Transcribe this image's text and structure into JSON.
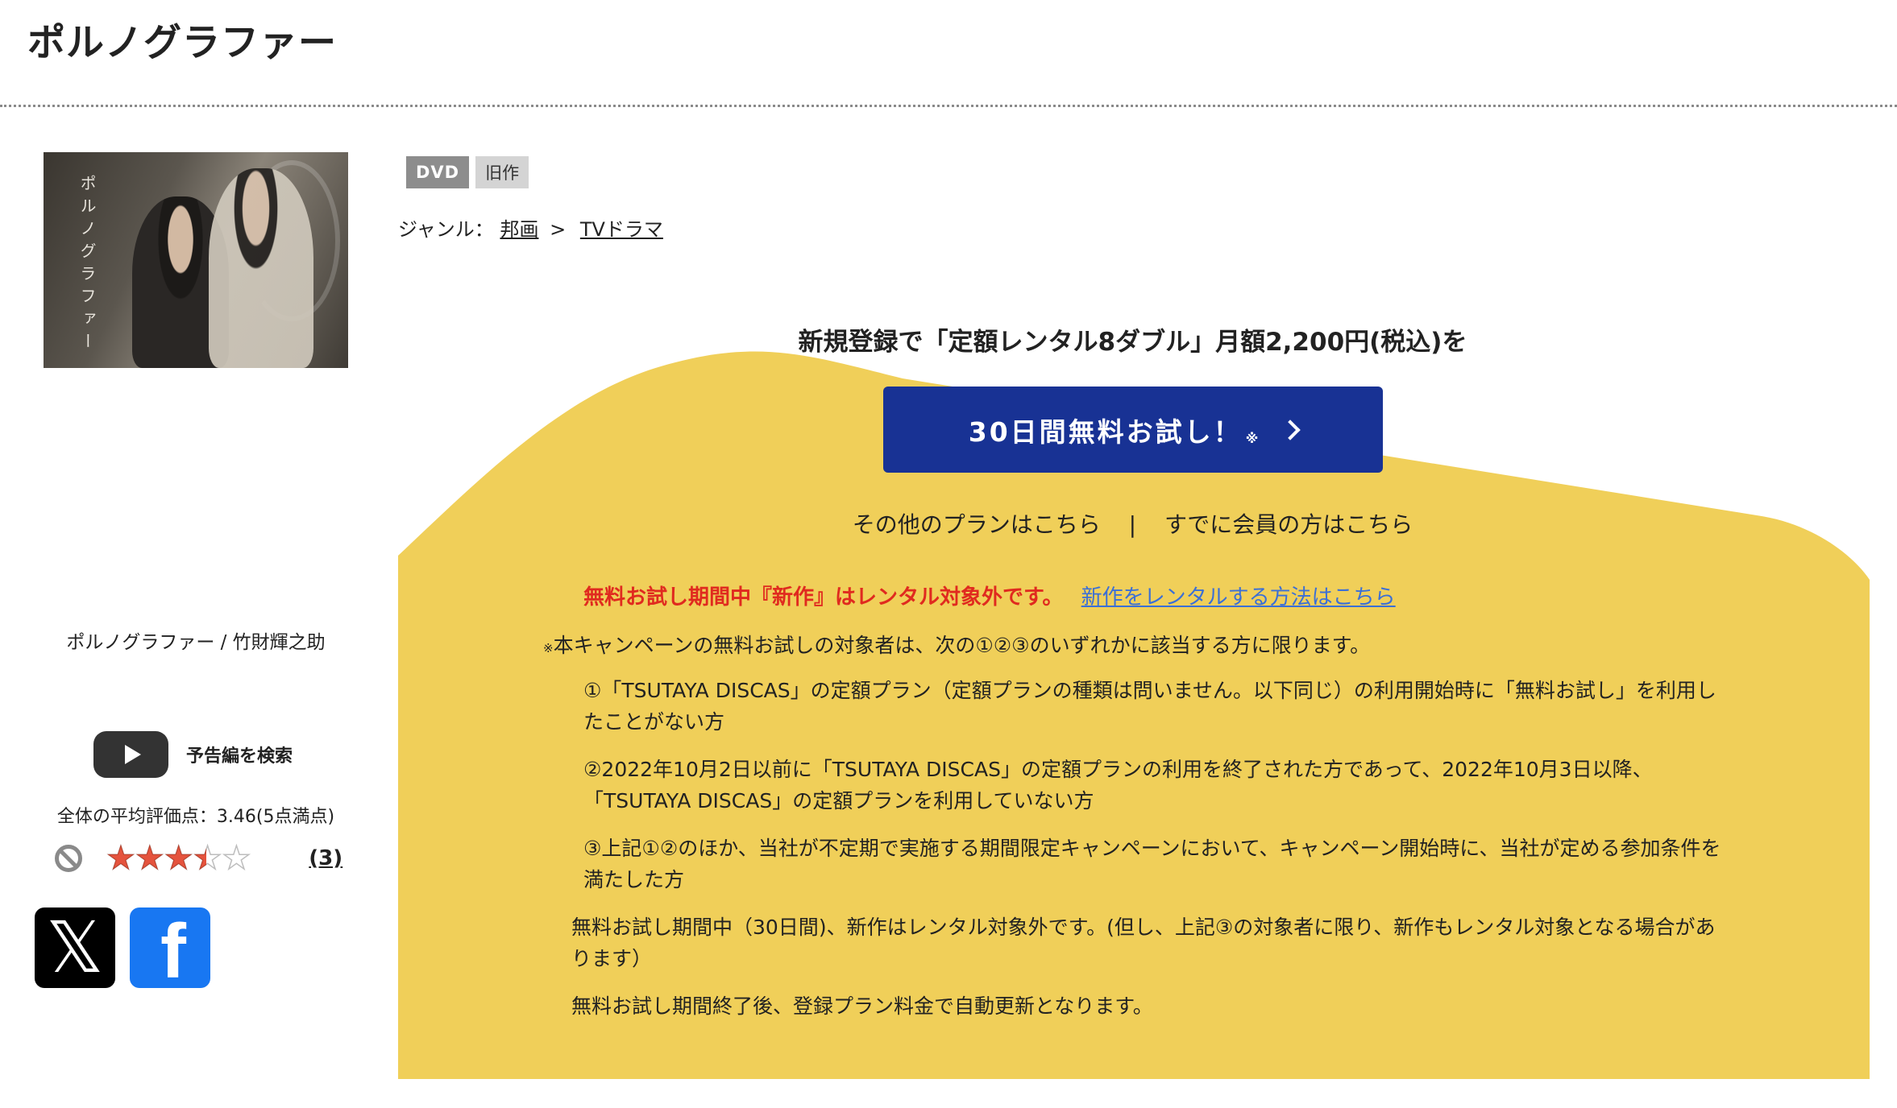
{
  "title": "ポルノグラファー",
  "cover": {
    "vertical_title": "ポルノグラファー"
  },
  "caption": "ポルノグラファー / 竹財輝之助",
  "trailer": {
    "label": "予告編を検索"
  },
  "rating": {
    "average_text": "全体の平均評価点：3.46(5点満点)",
    "score": 3.46,
    "max": 5,
    "stars_text": "★★★★★",
    "count_text": "(3)"
  },
  "share": {
    "x_glyph": "𝕏",
    "facebook_glyph": "f"
  },
  "tags": {
    "format": "DVD",
    "status": "旧作"
  },
  "genre": {
    "label": "ジャンル：",
    "parent": "邦画",
    "separator": ">",
    "child": "TVドラマ"
  },
  "promo": {
    "headline": "新規登録で「定額レンタル8ダブル」月額2,200円(税込)を",
    "cta_label": "30日間無料お試し！",
    "cta_note_mark": "※",
    "other_plans_link": "その他のプランはこちら",
    "links_separator": "|",
    "member_link": "すでに会員の方はこちら",
    "notice_red": "無料お試し期間中『新作』はレンタル対象外です。",
    "notice_link": "新作をレンタルする方法はこちら",
    "terms_mark": "※",
    "terms_lead": "本キャンペーンの無料お試しの対象者は、次の①②③のいずれかに該当する方に限ります。",
    "terms": [
      "①「TSUTAYA DISCAS」の定額プラン（定額プランの種類は問いません。以下同じ）の利用開始時に「無料お試し」を利用したことがない方",
      "②2022年10月2日以前に「TSUTAYA DISCAS」の定額プランの利用を終了された方であって、2022年10月3日以降、「TSUTAYA DISCAS」の定額プランを利用していない方",
      "③上記①②のほか、当社が不定期で実施する期間限定キャンペーンにおいて、キャンペーン開始時に、当社が定める参加条件を満たした方"
    ],
    "notes": [
      "無料お試し期間中（30日間)、新作はレンタル対象外です。(但し、上記③の対象者に限り、新作もレンタル対象となる場合があります）",
      "無料お試し期間終了後、登録プラン料金で自動更新となります。"
    ],
    "colors": {
      "panel": "#f0cf59",
      "cta": "#183294",
      "red_notice": "#e02a1f",
      "link": "#3b6fd6"
    }
  }
}
